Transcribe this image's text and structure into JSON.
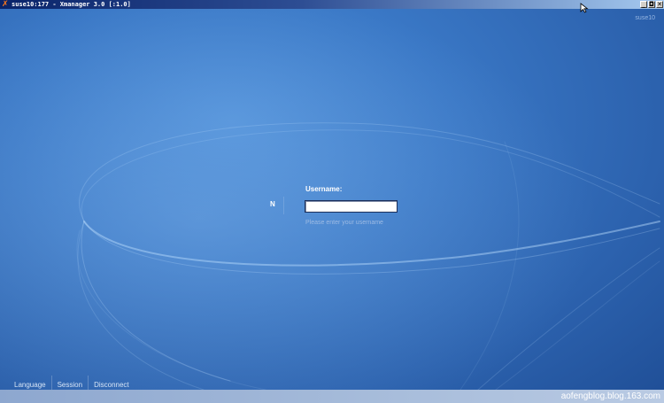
{
  "window": {
    "title": "suse10:177 - Xmanager 3.0 [:1.0]",
    "icon": "xmanager-x-icon",
    "controls": {
      "minimize": "_",
      "restore": "◘",
      "close": "✕"
    }
  },
  "top_right": {
    "hostname": "suse10"
  },
  "login": {
    "logo_letter": "N",
    "username_label": "Username:",
    "username_value": "",
    "hint": "Please enter your username"
  },
  "bottom_links": {
    "language": "Language",
    "session": "Session",
    "disconnect": "Disconnect"
  },
  "watermark": "aofengblog.blog.163.com",
  "colors": {
    "background": "#3a78c6",
    "titlebar": "#0a246a"
  }
}
